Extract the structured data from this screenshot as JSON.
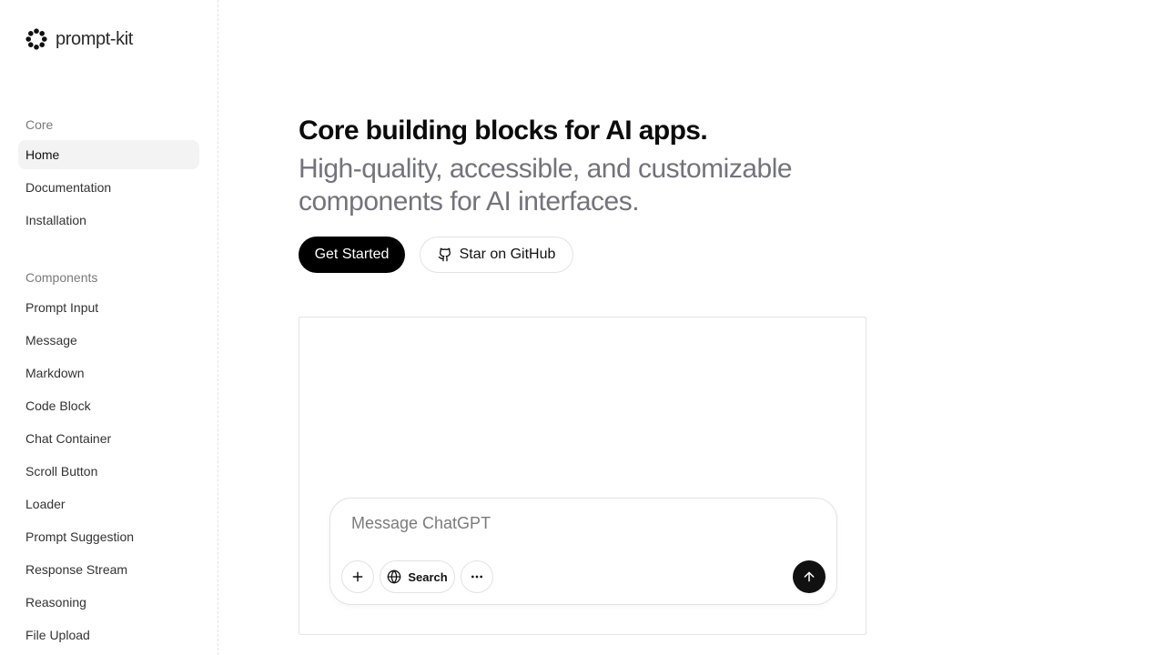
{
  "brand": {
    "name": "prompt-kit"
  },
  "sidebar": {
    "sections": [
      {
        "title": "Core",
        "items": [
          {
            "label": "Home",
            "active": true
          },
          {
            "label": "Documentation"
          },
          {
            "label": "Installation"
          }
        ]
      },
      {
        "title": "Components",
        "items": [
          {
            "label": "Prompt Input"
          },
          {
            "label": "Message"
          },
          {
            "label": "Markdown"
          },
          {
            "label": "Code Block"
          },
          {
            "label": "Chat Container"
          },
          {
            "label": "Scroll Button"
          },
          {
            "label": "Loader"
          },
          {
            "label": "Prompt Suggestion"
          },
          {
            "label": "Response Stream"
          },
          {
            "label": "Reasoning"
          },
          {
            "label": "File Upload"
          }
        ]
      }
    ]
  },
  "hero": {
    "title": "Core building blocks for AI apps.",
    "subtitle": "High-quality, accessible, and customizable components for AI interfaces.",
    "primary_button": "Get Started",
    "secondary_button": "Star on GitHub"
  },
  "demo": {
    "input_placeholder": "Message ChatGPT",
    "search_label": "Search"
  },
  "icons": {
    "brand": "prompt-kit-logo-icon",
    "github": "github-icon",
    "add": "plus-icon",
    "search": "globe-icon",
    "more": "more-horizontal-icon",
    "send": "arrow-up-icon"
  }
}
